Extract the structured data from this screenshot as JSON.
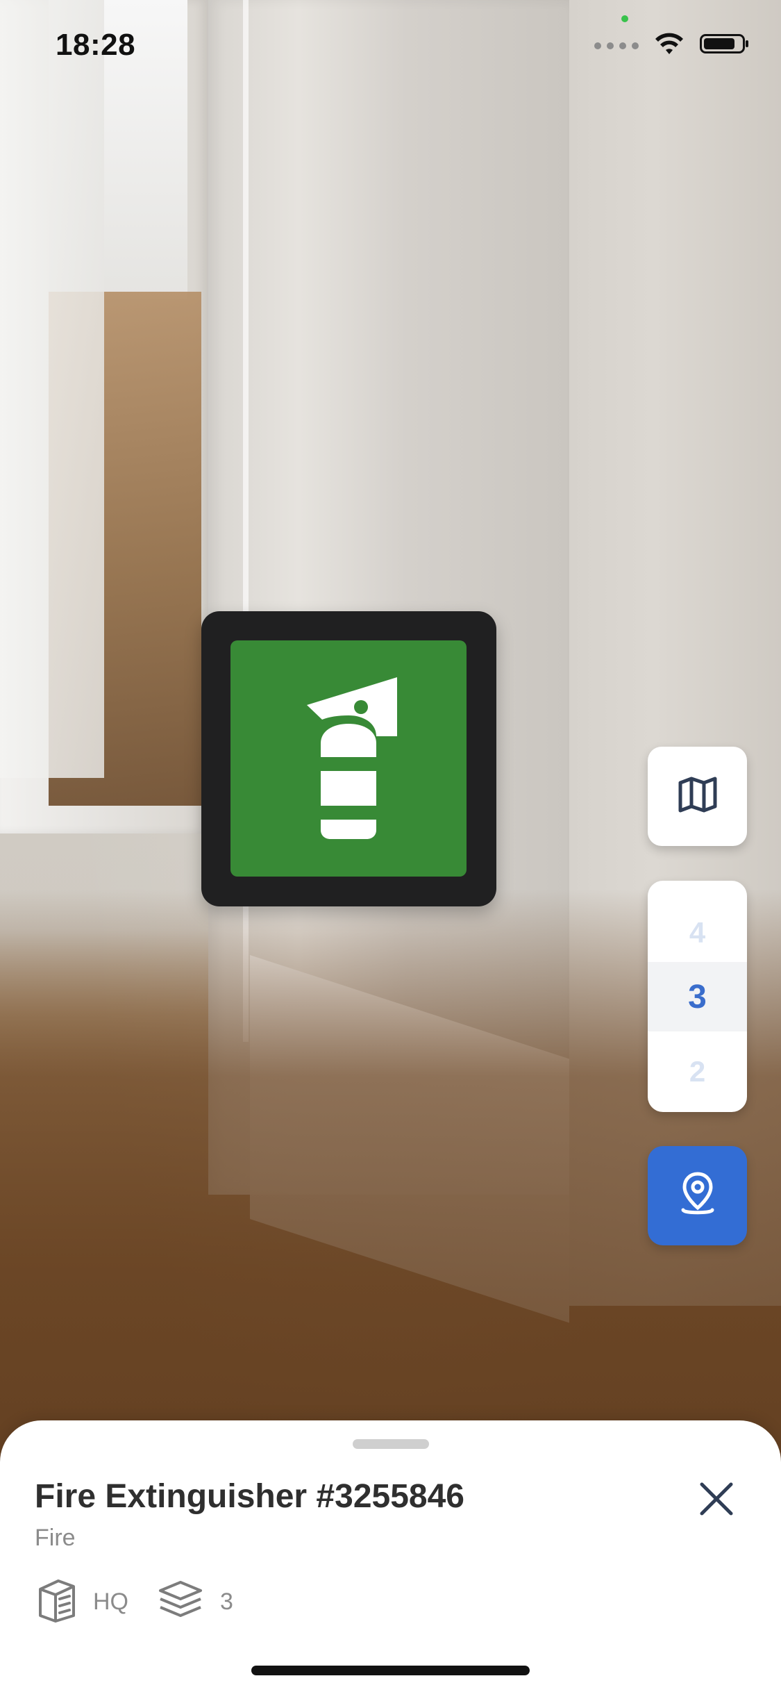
{
  "status_bar": {
    "time": "18:28"
  },
  "ar_marker": {
    "icon": "fire-extinguisher-icon",
    "colors": {
      "frame": "#202021",
      "tile": "#388a36"
    }
  },
  "controls": {
    "map_button_icon": "map-icon",
    "floor_picker": {
      "above": "4",
      "selected": "3",
      "below": "2"
    },
    "locate_button_icon": "location-pin-icon",
    "colors": {
      "accent": "#336dd4",
      "floor_selected": "#3a6dcc"
    }
  },
  "bottom_sheet": {
    "title": "Fire Extinguisher #3255846",
    "subtitle": "Fire",
    "close_icon": "close-icon",
    "meta": {
      "building_label": "HQ",
      "floor_label": "3"
    }
  }
}
